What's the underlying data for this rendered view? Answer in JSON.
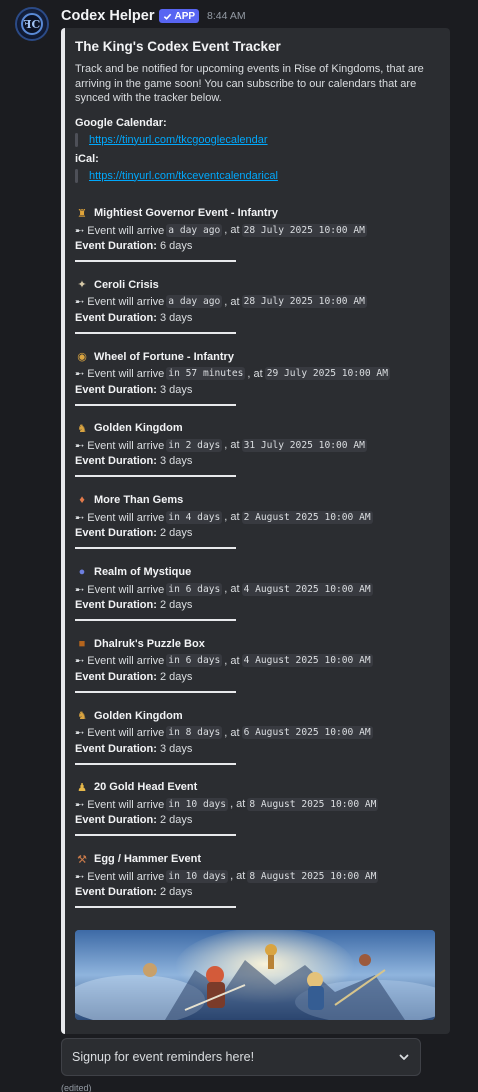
{
  "message": {
    "author": "Codex Helper",
    "badge": "APP",
    "time": "8:44 AM",
    "edited": "(edited)"
  },
  "embed": {
    "title": "The King's Codex Event Tracker",
    "description": "Track and be notified for upcoming events in Rise of Kingdoms, that are arriving in the game soon! You can subscribe to our calendars that are synced with the tracker below.",
    "google_label": "Google Calendar:",
    "google_link": "https://tinyurl.com/tkcgooglecalendar",
    "ical_label": "iCal:",
    "ical_link": "https://tinyurl.com/tkceventcalendarical"
  },
  "events": [
    {
      "icon": "governor-icon",
      "title": "Mightiest Governor Event - Infantry",
      "prefix": "➸ Event will arrive",
      "relative": "a day ago",
      "date": "28 July 2025 10:00 AM",
      "duration_label": "Event Duration:",
      "duration": "6 days"
    },
    {
      "icon": "ceroli-icon",
      "title": "Ceroli Crisis",
      "prefix": "➸ Event will arrive",
      "relative": "a day ago",
      "date": "28 July 2025 10:00 AM",
      "duration_label": "Event Duration:",
      "duration": "3 days"
    },
    {
      "icon": "wheel-icon",
      "title": "Wheel of Fortune - Infantry",
      "prefix": "➸ Event will arrive",
      "relative": "in 57 minutes",
      "date": "29 July 2025 10:00 AM",
      "duration_label": "Event Duration:",
      "duration": "3 days"
    },
    {
      "icon": "golden-kingdom-icon",
      "title": "Golden Kingdom",
      "prefix": "➸ Event will arrive",
      "relative": "in 2 days",
      "date": "31 July 2025 10:00 AM",
      "duration_label": "Event Duration:",
      "duration": "3 days"
    },
    {
      "icon": "gems-icon",
      "title": "More Than Gems",
      "prefix": "➸ Event will arrive",
      "relative": "in 4 days",
      "date": "2 August 2025 10:00 AM",
      "duration_label": "Event Duration:",
      "duration": "2 days"
    },
    {
      "icon": "mystique-icon",
      "title": "Realm of Mystique",
      "prefix": "➸ Event will arrive",
      "relative": "in 6 days",
      "date": "4 August 2025 10:00 AM",
      "duration_label": "Event Duration:",
      "duration": "2 days"
    },
    {
      "icon": "puzzle-box-icon",
      "title": "Dhalruk's Puzzle Box",
      "prefix": "➸ Event will arrive",
      "relative": "in 6 days",
      "date": "4 August 2025 10:00 AM",
      "duration_label": "Event Duration:",
      "duration": "2 days"
    },
    {
      "icon": "golden-kingdom-icon",
      "title": "Golden Kingdom",
      "prefix": "➸ Event will arrive",
      "relative": "in 8 days",
      "date": "6 August 2025 10:00 AM",
      "duration_label": "Event Duration:",
      "duration": "3 days"
    },
    {
      "icon": "gold-head-icon",
      "title": "20 Gold Head Event",
      "prefix": "➸ Event will arrive",
      "relative": "in 10 days",
      "date": "8 August 2025 10:00 AM",
      "duration_label": "Event Duration:",
      "duration": "2 days"
    },
    {
      "icon": "hammer-icon",
      "title": "Egg / Hammer Event",
      "prefix": "➸ Event will arrive",
      "relative": "in 10 days",
      "date": "8 August 2025 10:00 AM",
      "duration_label": "Event Duration:",
      "duration": "2 days"
    }
  ],
  "select": {
    "placeholder": "Signup for event reminders here!"
  },
  "colors": {
    "accent": "#5865f2",
    "link": "#00a8fc",
    "embed_border": "#e8e9ec"
  }
}
